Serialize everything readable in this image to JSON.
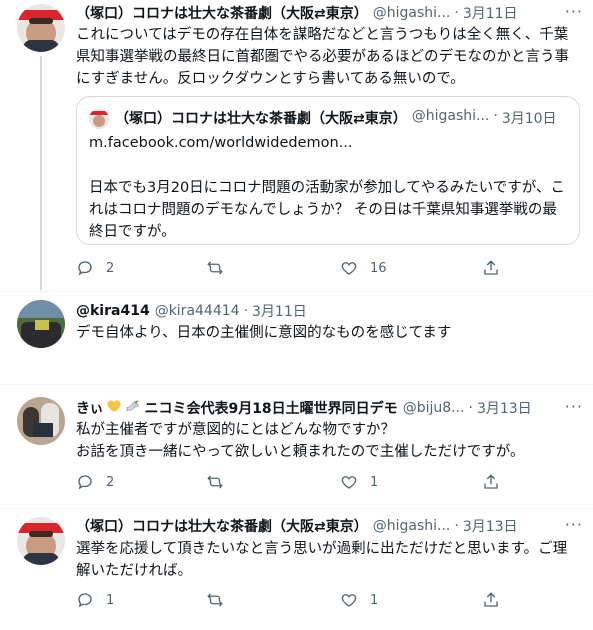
{
  "tweets": [
    {
      "name": "（塚口）コロナは壮大な茶番劇（大阪⇄東京）",
      "handle": "@higashi...",
      "date": "3月11日",
      "more": "···",
      "text": "これについてはデモの存在自体を謀略だなどと言うつもりは全く無く、千葉県知事選挙戦の最終日に首都圏でやる必要があるほどのデモなのかと言う事にすぎません。反ロックダウンとすら書いてある無いので。",
      "quote": {
        "name": "（塚口）コロナは壮大な茶番劇（大阪⇄東京）",
        "handle": "@higashi...",
        "date": "3月10日",
        "link": "m.facebook.com/worldwidedemon...",
        "text": "日本でも3月20日にコロナ問題の活動家が参加してやるみたいですが、これはコロナ問題のデモなんでしょうか？ その日は千葉県知事選挙戦の最終日ですが。"
      },
      "actions": {
        "reply": "2",
        "retweet": "",
        "like": "16"
      }
    },
    {
      "name": "@kira414",
      "handle": "@kira44414",
      "date": "3月11日",
      "more": "",
      "text": "デモ自体より、日本の主催側に意図的なものを感じてます",
      "actions": {
        "reply": "",
        "retweet": "",
        "like": ""
      }
    },
    {
      "name": "ニコミ会代表9月18日土曜世界同日デモ",
      "name_prefix": "きぃ",
      "handle": "@biju8...",
      "date": "3月13日",
      "more": "···",
      "text": "私が主催者ですが意図的にとはどんな物ですか？\nお話を頂き一緒にやって欲しいと頼まれたので主催しただけですが。",
      "actions": {
        "reply": "2",
        "retweet": "",
        "like": "1"
      }
    },
    {
      "name": "（塚口）コロナは壮大な茶番劇（大阪⇄東京）",
      "handle": "@higashi...",
      "date": "3月13日",
      "more": "···",
      "text": "選挙を応援して頂きたいなと言う思いが過剰に出ただけだと思います。ご理解いただければ。",
      "actions": {
        "reply": "1",
        "retweet": "",
        "like": "1"
      }
    }
  ],
  "colors": {
    "text": "#0f1419",
    "secondary": "#536471",
    "border": "#cfd9de",
    "brand_red": "#d8262c"
  },
  "icons": [
    "reply-icon",
    "retweet-icon",
    "like-icon",
    "share-icon",
    "more-icon",
    "heart-emoji-icon",
    "dove-emoji-icon"
  ]
}
